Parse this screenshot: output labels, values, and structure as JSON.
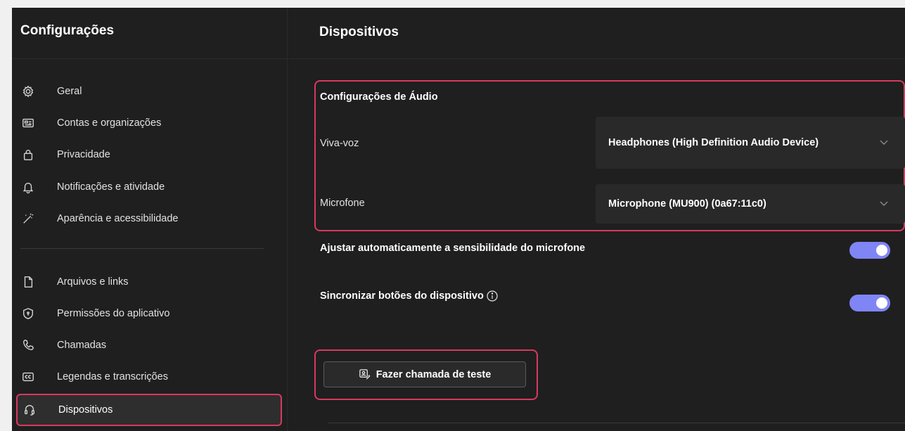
{
  "sidebar": {
    "title": "Configurações",
    "items": [
      {
        "label": "Geral",
        "icon": "gear-icon"
      },
      {
        "label": "Contas e organizações",
        "icon": "id-card-icon"
      },
      {
        "label": "Privacidade",
        "icon": "lock-icon"
      },
      {
        "label": "Notificações e atividade",
        "icon": "bell-icon"
      },
      {
        "label": "Aparência e acessibilidade",
        "icon": "magic-wand-icon"
      },
      {
        "label": "Arquivos e links",
        "icon": "file-icon"
      },
      {
        "label": "Permissões do aplicativo",
        "icon": "shield-icon"
      },
      {
        "label": "Chamadas",
        "icon": "phone-icon"
      },
      {
        "label": "Legendas e transcrições",
        "icon": "closed-captions-icon"
      },
      {
        "label": "Dispositivos",
        "icon": "headset-icon",
        "active": true
      }
    ]
  },
  "main": {
    "title": "Dispositivos",
    "audio": {
      "section_title": "Configurações de Áudio",
      "speaker_label": "Viva-voz",
      "speaker_value": "Headphones (High Definition Audio Device)",
      "microphone_label": "Microfone",
      "microphone_value": "Microphone (MU900) (0a67:11c0)"
    },
    "toggles": [
      {
        "label": "Ajustar automaticamente a sensibilidade do microfone",
        "on": true
      },
      {
        "label": "Sincronizar botões do dispositivo",
        "on": true
      }
    ],
    "test_call_label": "Fazer chamada de teste"
  },
  "colors": {
    "background": "#1f1f1f",
    "highlight": "#d8395f",
    "toggle_on": "#7f85f5"
  }
}
